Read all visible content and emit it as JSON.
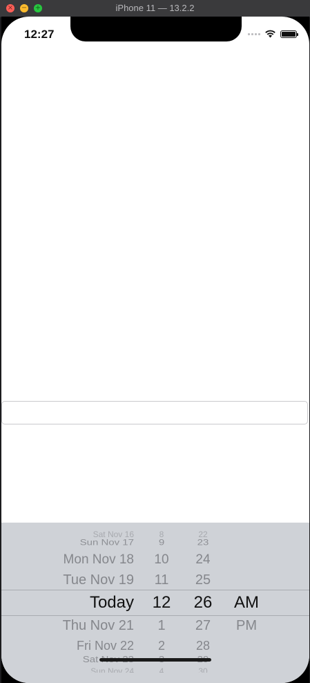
{
  "window": {
    "title": "iPhone 11 — 13.2.2"
  },
  "status_bar": {
    "time": "12:27"
  },
  "text_field": {
    "value": ""
  },
  "date_picker": {
    "rows": [
      {
        "date": "Sat Nov 16",
        "hour": "8",
        "minute": "22",
        "ampm": ""
      },
      {
        "date": "Sun Nov 17",
        "hour": "9",
        "minute": "23",
        "ampm": ""
      },
      {
        "date": "Mon Nov 18",
        "hour": "10",
        "minute": "24",
        "ampm": ""
      },
      {
        "date": "Tue Nov 19",
        "hour": "11",
        "minute": "25",
        "ampm": ""
      },
      {
        "date": "Today",
        "hour": "12",
        "minute": "26",
        "ampm": "AM"
      },
      {
        "date": "Thu Nov 21",
        "hour": "1",
        "minute": "27",
        "ampm": "PM"
      },
      {
        "date": "Fri Nov 22",
        "hour": "2",
        "minute": "28",
        "ampm": ""
      },
      {
        "date": "Sat Nov 23",
        "hour": "3",
        "minute": "29",
        "ampm": ""
      },
      {
        "date": "Sun Nov 24",
        "hour": "4",
        "minute": "30",
        "ampm": ""
      }
    ]
  },
  "colors": {
    "picker_bg": "#cfd2d7",
    "screen_bg": "#ffffff"
  }
}
